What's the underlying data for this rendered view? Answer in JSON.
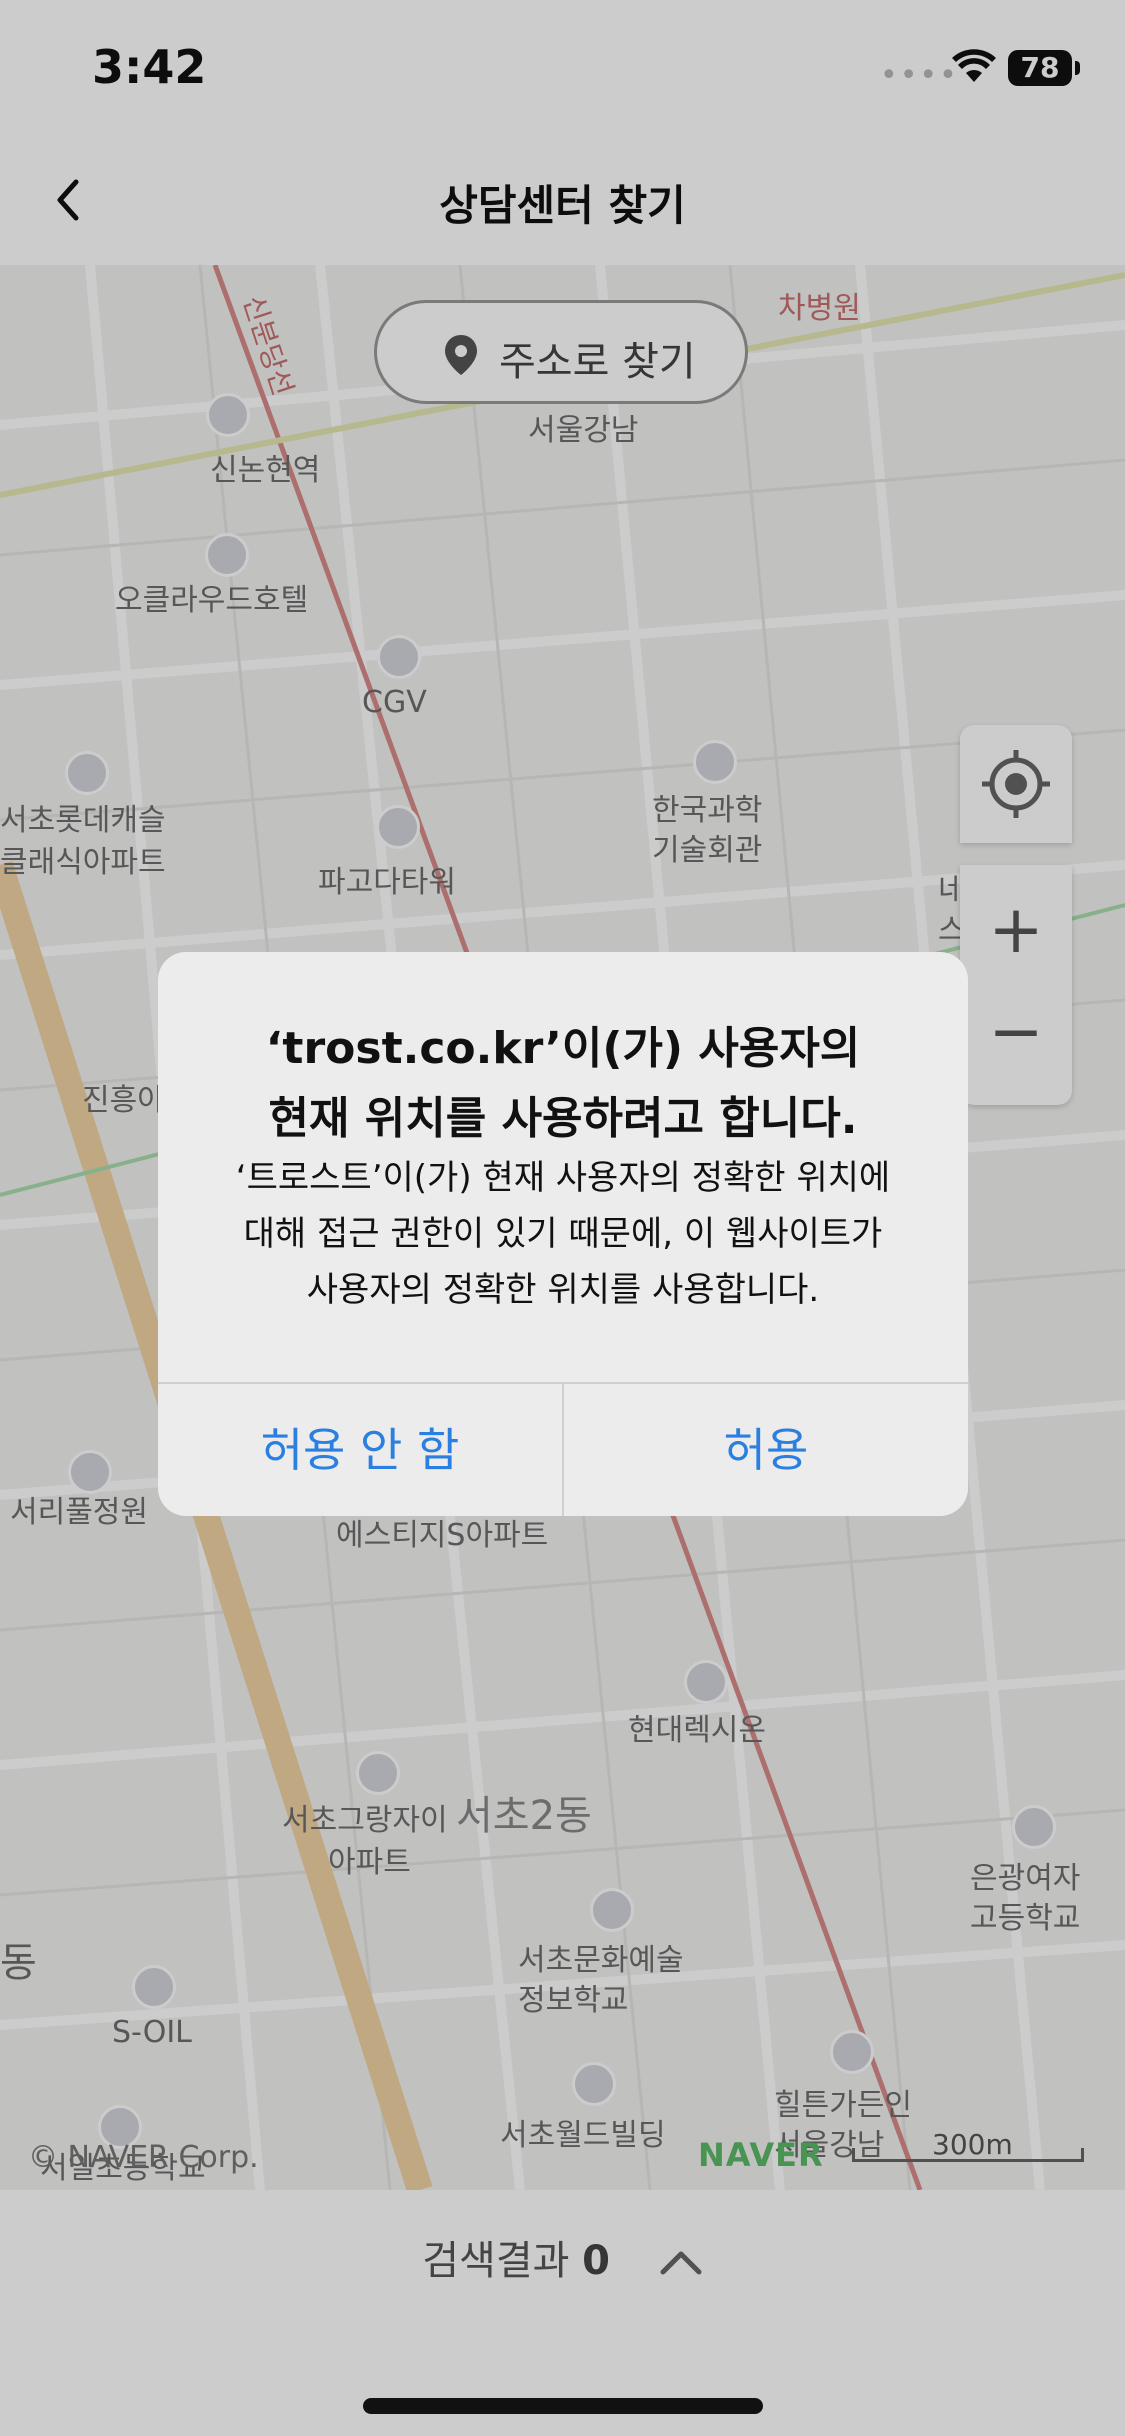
{
  "status_bar": {
    "time": "3:42",
    "signal": "••••",
    "battery": "78"
  },
  "header": {
    "title": "상담센터 찾기"
  },
  "map": {
    "address_button": "주소로 찾기",
    "labels": [
      "차병원",
      "신논현역",
      "서울강남",
      "오클라우드호텔",
      "CGV",
      "서초롯데캐슬",
      "클래식아파트",
      "한국과학",
      "기술회관",
      "파고다타워",
      "네이버",
      "스퀘어",
      "진흥아",
      "서리풀정원",
      "에스티지S아파트",
      "현대렉시온",
      "서초그랑자이",
      "아파트",
      "서초2동",
      "은광여자",
      "고등학교",
      "서초문화예술",
      "정보학교",
      "S-OIL",
      "서초월드빌딩",
      "힐튼가든인",
      "서울강남",
      "동",
      "서일초등학교",
      "신분당선"
    ],
    "copyright": "© NAVER Corp.",
    "naver_logo": "NAVER",
    "scale": "300m"
  },
  "bottom": {
    "result_label": "검색결과",
    "result_count": "0"
  },
  "alert": {
    "title_line1": "‘trost.co.kr’이(가) 사용자의",
    "title_line2": "현재 위치를 사용하려고 합니다.",
    "message_line1": "‘트로스트’이(가) 현재 사용자의 정확한 위치에",
    "message_line2": "대해 접근 권한이 있기 때문에, 이 웹사이트가",
    "message_line3": "사용자의 정확한 위치를 사용합니다.",
    "deny": "허용 안 함",
    "allow": "허용"
  }
}
